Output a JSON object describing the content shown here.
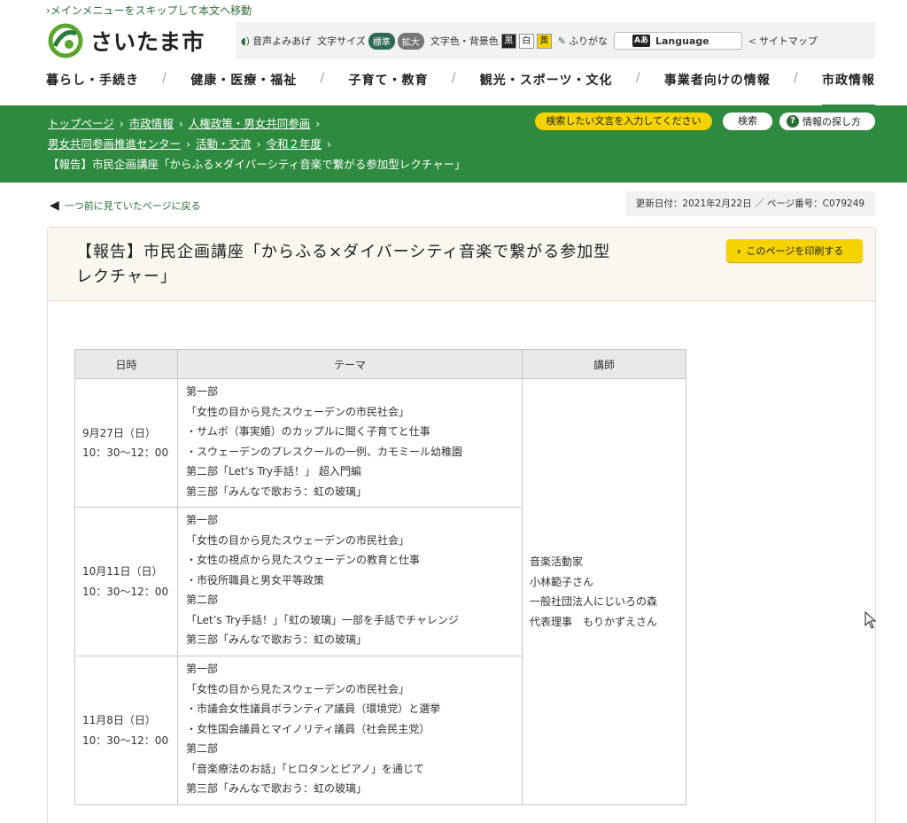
{
  "skip_link": "›メインメニューをスキップして本文へ移動",
  "site": {
    "name": "さいたま市"
  },
  "utility": {
    "voice": "音声よみあげ",
    "font_size_label": "文字サイズ",
    "font_standard": "標準",
    "font_large": "拡大",
    "color_label": "文字色・背景色",
    "color_black": "黒",
    "color_white": "白",
    "color_yellow": "黄",
    "furigana": "ふりがな",
    "language_icon": "Aあ",
    "language": "Language",
    "sitemap": "サイトマップ"
  },
  "global_nav": [
    "暮らし・手続き",
    "健康・医療・福祉",
    "子育て・教育",
    "観光・スポーツ・文化",
    "事業者向けの情報",
    "市政情報"
  ],
  "nav_separator": "/",
  "breadcrumb": {
    "items": [
      "トップページ",
      "市政情報",
      "人権政策・男女共同参画",
      "男女共同参画推進センター",
      "活動・交流",
      "令和２年度"
    ],
    "current": "【報告】市民企画講座「からふる×ダイバーシティ音楽で繋がる参加型レクチャー」",
    "arrow": "›"
  },
  "search": {
    "placeholder": "検索したい文言を入力してください",
    "button": "検索",
    "howto": "情報の探し方",
    "howto_icon": "?"
  },
  "back_link": "一つ前に見ていたページに戻る",
  "page_meta": "更新日付：2021年2月22日 ／ ページ番号：C079249",
  "article": {
    "title_line1": "【報告】市民企画講座「からふる×ダイバーシティ音楽で繋がる参加型",
    "title_line2": "レクチャー」",
    "print_button": "このページを印刷する"
  },
  "table": {
    "headers": [
      "日時",
      "テーマ",
      "講師"
    ],
    "rows": [
      {
        "date": "9月27日（日）",
        "time": "10：30〜12：00",
        "theme": [
          "第一部",
          "「女性の目から見たスウェーデンの市民社会」",
          "・サムボ（事実婚）のカップルに聞く子育てと仕事",
          "・スウェーデンのプレスクールの一例、カモミール幼稚園",
          "第二部「Let’s Try手話！」 超入門編",
          "第三部「みんなで歌おう：虹の玻璃」"
        ]
      },
      {
        "date": "10月11日（日）",
        "time": "10：30〜12：00",
        "theme": [
          "第一部",
          "「女性の目から見たスウェーデンの市民社会」",
          "・女性の視点から見たスウェーデンの教育と仕事",
          "・市役所職員と男女平等政策",
          "第二部",
          "「Let’s Try手話！」「虹の玻璃」一部を手話でチャレンジ",
          "第三部「みんなで歌おう：虹の玻璃」"
        ]
      },
      {
        "date": "11月8日（日）",
        "time": "10：30〜12：00",
        "theme": [
          "第一部",
          "「女性の目から見たスウェーデンの市民社会」",
          "・市議会女性議員ボランティア議員（環境党）と選挙",
          "・女性国会議員とマイノリティ議員（社会民主党）",
          "第二部",
          "「音楽療法のお話」「ヒロタンとピアノ」を通じて",
          "第三部「みんなで歌おう：虹の玻璃」"
        ]
      }
    ],
    "lecturer": [
      "音楽活動家",
      "小林範子さん",
      "一般社団法人にじいろの森",
      "代表理事　もりかずえさん"
    ]
  },
  "colors": {
    "brand_green": "#2d8a3e",
    "accent_yellow": "#f5d300"
  }
}
